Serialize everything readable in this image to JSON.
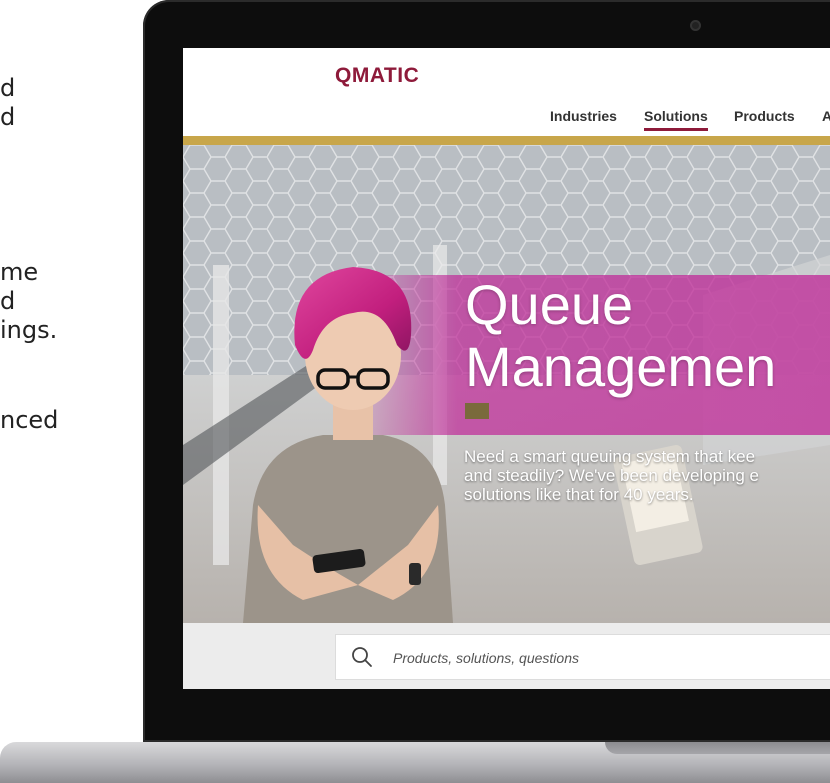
{
  "side_text": [
    "d",
    "d",
    "me",
    "d",
    "ings.",
    "nced"
  ],
  "site": {
    "logo": "QMATIC",
    "nav": [
      {
        "label": "Industries",
        "active": false
      },
      {
        "label": "Solutions",
        "active": true
      },
      {
        "label": "Products",
        "active": false
      },
      {
        "label": "A",
        "active": false
      }
    ],
    "hero": {
      "title_line1": "Queue",
      "title_line2": "Managemen",
      "subtitle_line1": "Need a smart queuing system that kee",
      "subtitle_line2": "and steadily? We've been developing e",
      "subtitle_line3": "solutions like that for 40 years."
    },
    "search": {
      "placeholder": "Products, solutions, questions"
    }
  },
  "colors": {
    "brand": "#8e1a3a",
    "gold": "#c8a64a",
    "banner": "#c0309a"
  }
}
